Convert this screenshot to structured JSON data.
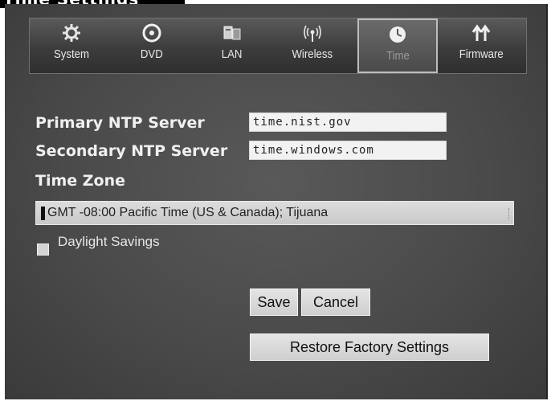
{
  "page_title": "Time Settings",
  "tabs": [
    {
      "label": "System",
      "icon": "gear-icon"
    },
    {
      "label": "DVD",
      "icon": "disc-icon"
    },
    {
      "label": "LAN",
      "icon": "network-icon"
    },
    {
      "label": "Wireless",
      "icon": "wireless-icon"
    },
    {
      "label": "Time",
      "icon": "clock-icon",
      "active": true
    },
    {
      "label": "Firmware",
      "icon": "update-arrows-icon"
    }
  ],
  "form": {
    "primary_ntp_label": "Primary NTP Server",
    "primary_ntp_value": "time.nist.gov",
    "secondary_ntp_label": "Secondary NTP Server",
    "secondary_ntp_value": "time.windows.com",
    "time_zone_label": "Time Zone",
    "time_zone_value": "GMT -08:00 Pacific Time (US & Canada); Tijuana",
    "daylight_savings_label": "Daylight Savings",
    "daylight_savings_checked": false
  },
  "buttons": {
    "save": "Save",
    "cancel": "Cancel",
    "restore": "Restore Factory Settings"
  },
  "colors": {
    "background": "#4a4a4a",
    "tab_bar": "#3c3c3c",
    "input": "#f2f2f2",
    "button": "#d9d9d9"
  }
}
